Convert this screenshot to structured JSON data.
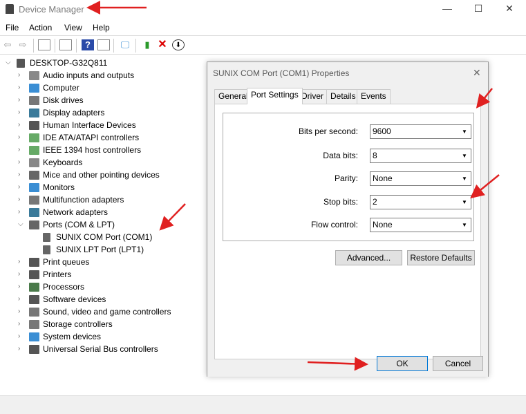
{
  "window": {
    "title": "Device Manager",
    "minimize": "—",
    "maximize": "☐",
    "close": "✕"
  },
  "menu": [
    "File",
    "Action",
    "View",
    "Help"
  ],
  "tree": {
    "root": "DESKTOP-G32Q811",
    "items": [
      {
        "label": "Audio inputs and outputs",
        "color": "#888"
      },
      {
        "label": "Computer",
        "color": "#3a8ed4"
      },
      {
        "label": "Disk drives",
        "color": "#777"
      },
      {
        "label": "Display adapters",
        "color": "#3a7a9a"
      },
      {
        "label": "Human Interface Devices",
        "color": "#555"
      },
      {
        "label": "IDE ATA/ATAPI controllers",
        "color": "#6a6"
      },
      {
        "label": "IEEE 1394 host controllers",
        "color": "#6a6"
      },
      {
        "label": "Keyboards",
        "color": "#888"
      },
      {
        "label": "Mice and other pointing devices",
        "color": "#666"
      },
      {
        "label": "Monitors",
        "color": "#3a8ed4"
      },
      {
        "label": "Multifunction adapters",
        "color": "#777"
      },
      {
        "label": "Network adapters",
        "color": "#3a7a9a"
      },
      {
        "label": "Ports (COM & LPT)",
        "color": "#666",
        "expanded": true,
        "children": [
          "SUNIX COM Port (COM1)",
          "SUNIX LPT Port (LPT1)"
        ]
      },
      {
        "label": "Print queues",
        "color": "#555"
      },
      {
        "label": "Printers",
        "color": "#555"
      },
      {
        "label": "Processors",
        "color": "#4a7a4a"
      },
      {
        "label": "Software devices",
        "color": "#555"
      },
      {
        "label": "Sound, video and game controllers",
        "color": "#777"
      },
      {
        "label": "Storage controllers",
        "color": "#777"
      },
      {
        "label": "System devices",
        "color": "#3a8ed4"
      },
      {
        "label": "Universal Serial Bus controllers",
        "color": "#555"
      }
    ]
  },
  "dialog": {
    "title": "SUNIX COM Port (COM1) Properties",
    "tabs": [
      "General",
      "Port Settings",
      "Driver",
      "Details",
      "Events"
    ],
    "active_tab": "Port Settings",
    "fields": [
      {
        "label": "Bits per second:",
        "value": "9600"
      },
      {
        "label": "Data bits:",
        "value": "8"
      },
      {
        "label": "Parity:",
        "value": "None"
      },
      {
        "label": "Stop bits:",
        "value": "2"
      },
      {
        "label": "Flow control:",
        "value": "None"
      }
    ],
    "advanced": "Advanced...",
    "restore": "Restore Defaults",
    "ok": "OK",
    "cancel": "Cancel",
    "close": "✕"
  },
  "annotation_color": "#e02020"
}
